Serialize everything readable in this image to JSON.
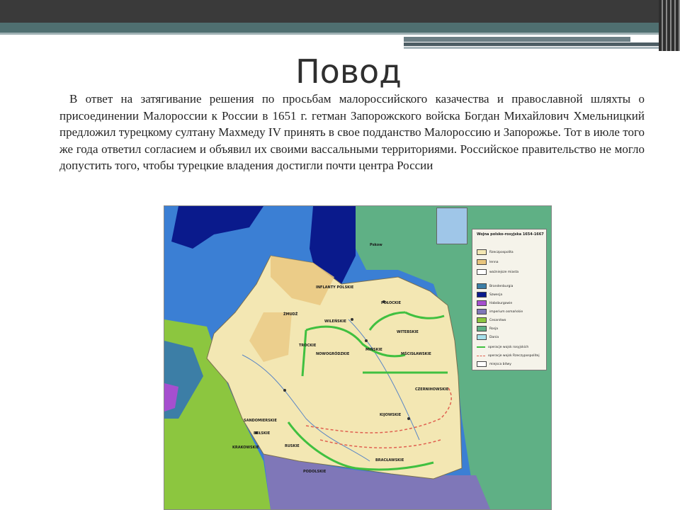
{
  "slide": {
    "title": "Повод",
    "body_text": "В ответ на затягивание решения по просьбам малороссийского казачества и православной шляхты о присоединении Малороссии к России в 1651 г. гетман Запорожского войска Богдан Михайлович Хмельницкий предложил турецкому султану Махмеду IV принять в свое подданство Малороссию и Запорожье. Тот в июле того же года ответил согласием и объявил их своими вассальными территориями. Российское правительство не могло допустить того, чтобы турецкие владения достигли почти центра России"
  },
  "map": {
    "legend": {
      "title": "Wojna polsko-rosyjska 1654-1667",
      "items": [
        {
          "label": "Rzeczpospolita",
          "color": "#f3e7b3"
        },
        {
          "label": "lenna",
          "color": "#e8c57d"
        },
        {
          "label": "ważniejsze miasta",
          "color": ""
        },
        {
          "label": "Brandenburgia",
          "color": "#3c7ea6"
        },
        {
          "label": "Szwecja",
          "color": "#0a1a8c"
        },
        {
          "label": "Habsburgowie",
          "color": "#a64fcf"
        },
        {
          "label": "imperium osmańskie",
          "color": "#7f77b8"
        },
        {
          "label": "Cesarstwo",
          "color": "#8cc63f"
        },
        {
          "label": "Rosja",
          "color": "#5fb085"
        },
        {
          "label": "Dania",
          "color": "#a7e0ea"
        },
        {
          "label": "operacje wojsk rosyjskich",
          "color": "#40c040"
        },
        {
          "label": "operacje wojsk Rzeczypospolitej",
          "color": "#e06050"
        },
        {
          "label": "miejsca bitwy",
          "color": ""
        }
      ]
    },
    "labels": [
      {
        "text": "WILEŃSKIE"
      },
      {
        "text": "WITEBSKIE"
      },
      {
        "text": "POŁOCKIE"
      },
      {
        "text": "MIŃSKIE"
      },
      {
        "text": "MŚCISŁAWSKIE"
      },
      {
        "text": "NOWOGRÓDZKIE"
      },
      {
        "text": "TROCKIE"
      },
      {
        "text": "KIJOWSKIE"
      },
      {
        "text": "BRACŁAWSKIE"
      },
      {
        "text": "CZERNIHOWSKIE"
      },
      {
        "text": "RUSKIE"
      },
      {
        "text": "SANDOMIERSKIE"
      },
      {
        "text": "KRAKOWSKIE"
      },
      {
        "text": "INFLANTY POLSKIE"
      },
      {
        "text": "ŻMUDŹ"
      },
      {
        "text": "PODOLSKIE"
      },
      {
        "text": "BEŁSKIE"
      },
      {
        "text": "Pskow"
      }
    ]
  }
}
